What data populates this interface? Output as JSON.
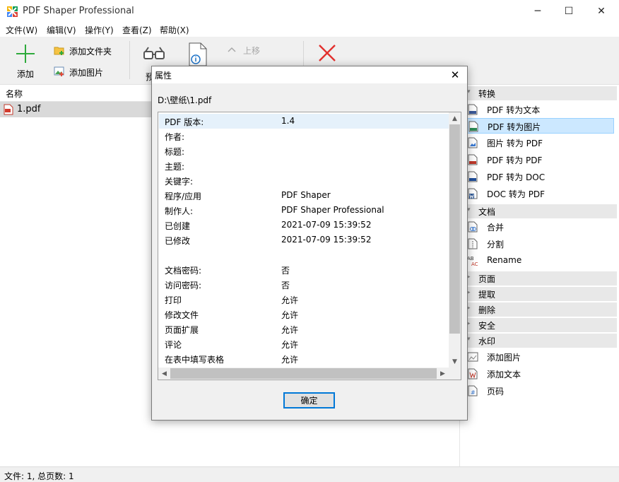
{
  "window": {
    "title": "PDF Shaper Professional",
    "minimize": "─",
    "maximize": "☐",
    "close": "✕"
  },
  "menu": [
    "文件(W)",
    "编辑(V)",
    "操作(Y)",
    "查看(Z)",
    "帮助(X)"
  ],
  "toolbar": {
    "add": "添加",
    "add_folder": "添加文件夹",
    "add_image": "添加图片",
    "preview": "预",
    "move_up": "上移"
  },
  "files": {
    "column_header": "名称",
    "items": [
      "1.pdf"
    ]
  },
  "sidebar": {
    "sections": [
      {
        "label": "转换",
        "items": [
          {
            "label": "PDF 转为文本",
            "icon": "txt-icon"
          },
          {
            "label": "PDF 转为图片",
            "icon": "jpg-icon",
            "selected": true
          },
          {
            "label": "图片 转为 PDF",
            "icon": "image-file-icon"
          },
          {
            "label": "PDF 转为 PDF",
            "icon": "pdf-icon"
          },
          {
            "label": "PDF 转为 DOC",
            "icon": "doc-icon"
          },
          {
            "label": "DOC 转为 PDF",
            "icon": "word-icon"
          }
        ]
      },
      {
        "label": "文档",
        "items": [
          {
            "label": "合并",
            "icon": "merge-icon"
          },
          {
            "label": "分割",
            "icon": "split-icon"
          },
          {
            "label": "Rename",
            "icon": "rename-icon"
          }
        ]
      },
      {
        "label": "页面",
        "items": []
      },
      {
        "label": "提取",
        "items": []
      },
      {
        "label": "删除",
        "items": []
      },
      {
        "label": "安全",
        "items": []
      },
      {
        "label": "水印",
        "items": [
          {
            "label": "添加图片",
            "icon": "watermark-image-icon"
          },
          {
            "label": "添加文本",
            "icon": "watermark-text-icon"
          },
          {
            "label": "页码",
            "icon": "page-number-icon"
          }
        ]
      }
    ]
  },
  "status": "文件: 1, 总页数: 1",
  "dialog": {
    "title": "属性",
    "close": "✕",
    "path": "D:\\壁纸\\1.pdf",
    "properties": [
      {
        "key": "PDF 版本:",
        "value": "1.4"
      },
      {
        "key": "作者:",
        "value": ""
      },
      {
        "key": "标题:",
        "value": ""
      },
      {
        "key": "主题:",
        "value": ""
      },
      {
        "key": "关键字:",
        "value": ""
      },
      {
        "key": "程序/应用",
        "value": "PDF Shaper"
      },
      {
        "key": "制作人:",
        "value": "PDF Shaper Professional"
      },
      {
        "key": "已创建",
        "value": "2021-07-09 15:39:52"
      },
      {
        "key": "已修改",
        "value": "2021-07-09 15:39:52"
      },
      {
        "key": "",
        "value": ""
      },
      {
        "key": "文档密码:",
        "value": "否"
      },
      {
        "key": "访问密码:",
        "value": "否"
      },
      {
        "key": "打印",
        "value": "允许"
      },
      {
        "key": "修改文件",
        "value": "允许"
      },
      {
        "key": "页面扩展",
        "value": "允许"
      },
      {
        "key": "评论",
        "value": "允许"
      },
      {
        "key": "在表中填写表格",
        "value": "允许"
      }
    ],
    "ok": "确定"
  }
}
